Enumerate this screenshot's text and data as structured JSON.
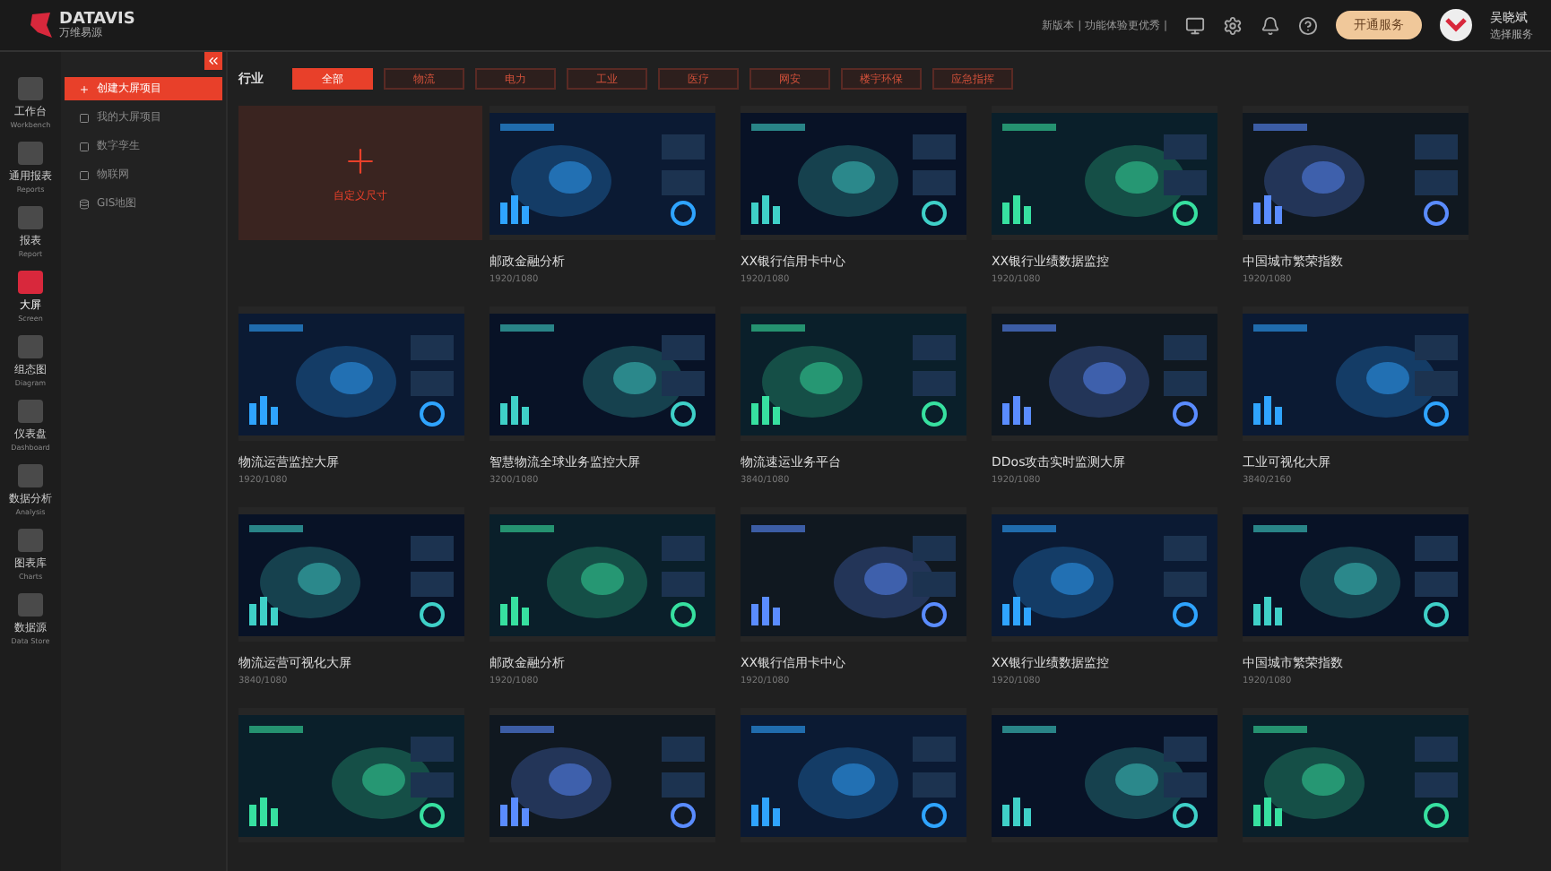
{
  "brand": {
    "name": "DATAVIS",
    "tagline": "万维易源"
  },
  "header": {
    "notice": "新版本 | 功能体验更优秀 |",
    "service_button": "开通服务",
    "user": {
      "name": "吴晓斌",
      "plan": "选择服务"
    }
  },
  "rail": [
    {
      "label": "工作台",
      "sublabel": "Workbench",
      "selected": false
    },
    {
      "label": "通用报表",
      "sublabel": "Reports",
      "selected": false
    },
    {
      "label": "报表",
      "sublabel": "Report",
      "selected": false
    },
    {
      "label": "大屏",
      "sublabel": "Screen",
      "selected": true
    },
    {
      "label": "组态图",
      "sublabel": "Diagram",
      "selected": false
    },
    {
      "label": "仪表盘",
      "sublabel": "Dashboard",
      "selected": false
    },
    {
      "label": "数据分析",
      "sublabel": "Analysis",
      "selected": false
    },
    {
      "label": "图表库",
      "sublabel": "Charts",
      "selected": false
    },
    {
      "label": "数据源",
      "sublabel": "Data Store",
      "selected": false
    }
  ],
  "subnav": [
    {
      "label": "创建大屏项目",
      "selected": true
    },
    {
      "label": "我的大屏项目",
      "selected": false
    },
    {
      "label": "数字孪生",
      "selected": false
    },
    {
      "label": "物联网",
      "selected": false
    },
    {
      "label": "GIS地图",
      "selected": false
    }
  ],
  "filter": {
    "label": "行业",
    "tabs": [
      {
        "label": "全部",
        "selected": true
      },
      {
        "label": "物流",
        "selected": false
      },
      {
        "label": "电力",
        "selected": false
      },
      {
        "label": "工业",
        "selected": false
      },
      {
        "label": "医疗",
        "selected": false
      },
      {
        "label": "网安",
        "selected": false
      },
      {
        "label": "楼宇环保",
        "selected": false
      },
      {
        "label": "应急指挥",
        "selected": false
      }
    ]
  },
  "create_card": {
    "label": "自定义尺寸"
  },
  "templates": [
    {
      "kind": "template",
      "title": "邮政金融分析",
      "size": "1920/1080"
    },
    {
      "kind": "template",
      "title": "XX银行信用卡中心",
      "size": "1920/1080"
    },
    {
      "kind": "template",
      "title": "XX银行业绩数据监控",
      "size": "1920/1080"
    },
    {
      "kind": "template",
      "title": "中国城市繁荣指数",
      "size": "1920/1080"
    },
    {
      "kind": "template",
      "title": "物流运营监控大屏",
      "size": "1920/1080"
    },
    {
      "kind": "template",
      "title": "智慧物流全球业务监控大屏",
      "size": "3200/1080"
    },
    {
      "kind": "template",
      "title": "物流速运业务平台",
      "size": "3840/1080"
    },
    {
      "kind": "template",
      "title": "DDos攻击实时监测大屏",
      "size": "1920/1080"
    },
    {
      "kind": "template",
      "title": "工业可视化大屏",
      "size": "3840/2160"
    },
    {
      "kind": "template",
      "title": "物流运营可视化大屏",
      "size": "3840/1080"
    },
    {
      "kind": "template",
      "title": "邮政金融分析",
      "size": "1920/1080"
    },
    {
      "kind": "template",
      "title": "XX银行信用卡中心",
      "size": "1920/1080"
    },
    {
      "kind": "template",
      "title": "XX银行业绩数据监控",
      "size": "1920/1080"
    },
    {
      "kind": "template",
      "title": "中国城市繁荣指数",
      "size": "1920/1080"
    },
    {
      "kind": "picture"
    },
    {
      "kind": "picture"
    },
    {
      "kind": "picture"
    },
    {
      "kind": "picture"
    },
    {
      "kind": "picture"
    }
  ]
}
